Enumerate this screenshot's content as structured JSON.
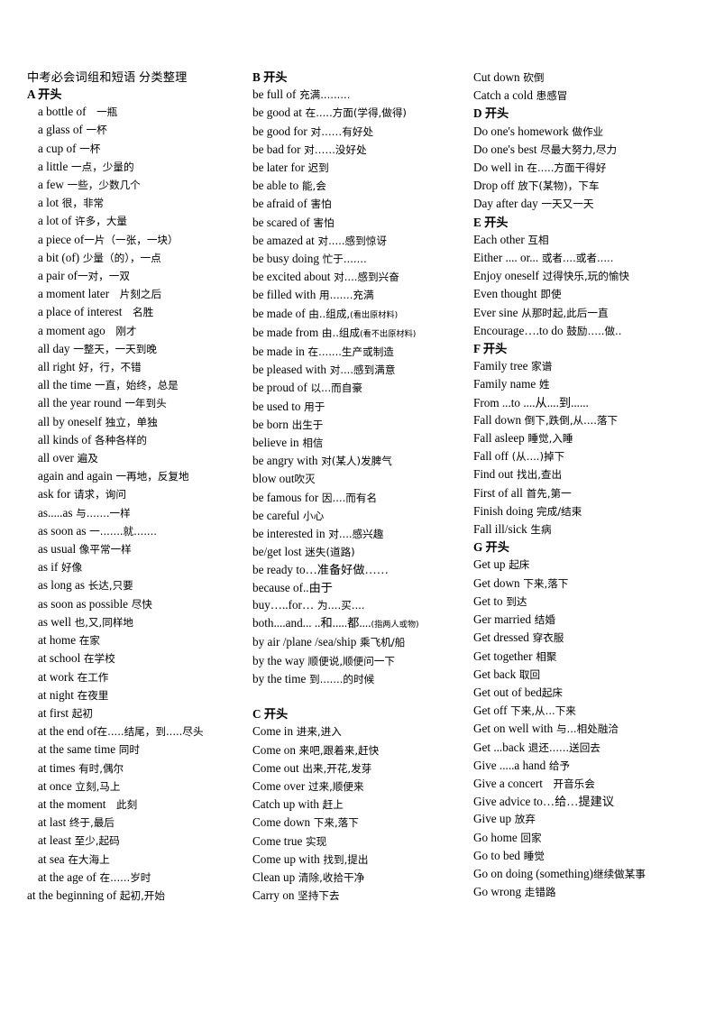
{
  "document": {
    "title": "中考必会词组和短语 分类整理"
  },
  "columns": [
    {
      "id": "column-1",
      "blocks": [
        {
          "type": "title",
          "text": "中考必会词组和短语 分类整理"
        },
        {
          "type": "heading",
          "text": "A 开头"
        },
        {
          "type": "entry",
          "en": "a bottle of",
          "cn": "　一瓶"
        },
        {
          "type": "entry",
          "en": "a glass of",
          "cn": " 一杯"
        },
        {
          "type": "entry",
          "en": "a cup of",
          "cn": " 一杯"
        },
        {
          "type": "entry",
          "en": "a little",
          "cn": " 一点，少量的"
        },
        {
          "type": "entry",
          "en": "a few",
          "cn": " 一些，少数几个"
        },
        {
          "type": "entry",
          "en": "a lot",
          "cn": " 很，非常"
        },
        {
          "type": "entry",
          "en": "a lot of",
          "cn": " 许多，大量"
        },
        {
          "type": "entry",
          "en": "a piece of",
          "cn": "一片（一张，一块）"
        },
        {
          "type": "entry",
          "en": "a bit (of)",
          "cn": " 少量（的），一点"
        },
        {
          "type": "entry",
          "en": "a pair of",
          "cn": "一对，一双"
        },
        {
          "type": "entry",
          "en": "a moment later",
          "cn": "　片刻之后"
        },
        {
          "type": "entry",
          "en": "a place of interest",
          "cn": "　名胜"
        },
        {
          "type": "entry",
          "en": "a moment ago",
          "cn": "　刚才"
        },
        {
          "type": "entry",
          "en": "all day",
          "cn": " 一整天，一天到晚"
        },
        {
          "type": "entry",
          "en": "all right",
          "cn": " 好，行，不错"
        },
        {
          "type": "entry",
          "en": "all the time",
          "cn": " 一直，始终，总是"
        },
        {
          "type": "entry",
          "en": "all the year round",
          "cn": " 一年到头"
        },
        {
          "type": "entry",
          "en": "all by oneself",
          "cn": " 独立，单独"
        },
        {
          "type": "entry",
          "en": "all kinds of",
          "cn": " 各种各样的"
        },
        {
          "type": "entry",
          "en": "all over",
          "cn": " 遍及"
        },
        {
          "type": "entry",
          "en": "again and again",
          "cn": " 一再地，反复地"
        },
        {
          "type": "entry",
          "en": "ask for",
          "cn": " 请求，询问"
        },
        {
          "type": "entry",
          "en": "as.....as",
          "cn": " 与.......一样"
        },
        {
          "type": "entry",
          "en": "as  soon   as",
          "cn": " 一.......就......."
        },
        {
          "type": "entry",
          "en": "as usual",
          "cn": " 像平常一样"
        },
        {
          "type": "entry",
          "en": "as if",
          "cn": " 好像"
        },
        {
          "type": "entry",
          "en": "as long as",
          "cn": " 长达,只要"
        },
        {
          "type": "entry",
          "en": "as soon as possible",
          "cn": " 尽快"
        },
        {
          "type": "entry",
          "en": "as well",
          "cn": " 也,又,同样地"
        },
        {
          "type": "entry",
          "en": "at home",
          "cn": " 在家"
        },
        {
          "type": "entry",
          "en": "at school",
          "cn": " 在学校"
        },
        {
          "type": "entry",
          "en": "at work",
          "cn": " 在工作"
        },
        {
          "type": "entry",
          "en": "at night",
          "cn": " 在夜里"
        },
        {
          "type": "entry",
          "en": "at first",
          "cn": " 起初"
        },
        {
          "type": "entry",
          "en": "at the end of",
          "cn": "在.....结尾，到.....尽头"
        },
        {
          "type": "entry",
          "en": "at the same time",
          "cn": " 同时"
        },
        {
          "type": "entry",
          "en": "at times",
          "cn": " 有时,偶尔"
        },
        {
          "type": "entry",
          "en": "at once",
          "cn": " 立刻,马上"
        },
        {
          "type": "entry",
          "en": "at the moment",
          "cn": "　此刻"
        },
        {
          "type": "entry",
          "en": "at last",
          "cn": " 终于,最后"
        },
        {
          "type": "entry",
          "en": "at least",
          "cn": " 至少,起码"
        },
        {
          "type": "entry",
          "en": "at sea",
          "cn": " 在大海上"
        },
        {
          "type": "entry",
          "en": "at the age of",
          "cn": " 在......岁时"
        },
        {
          "type": "entry",
          "en": "at the beginning of",
          "cn": " 起初,开始",
          "flush": true
        }
      ]
    },
    {
      "id": "column-2",
      "blocks": [
        {
          "type": "heading",
          "text": "B 开头"
        },
        {
          "type": "entry",
          "en": "be full of",
          "cn": " 充满........."
        },
        {
          "type": "entry",
          "en": "be good at",
          "cn": " 在.....方面(学得,做得)"
        },
        {
          "type": "entry",
          "en": "be good for",
          "cn": " 对……有好处"
        },
        {
          "type": "entry",
          "en": "be bad for",
          "cn": " 对……没好处"
        },
        {
          "type": "entry",
          "en": "be later for",
          "cn": " 迟到"
        },
        {
          "type": "entry",
          "en": "be able to",
          "cn": " 能,会"
        },
        {
          "type": "entry",
          "en": "be afraid of",
          "cn": " 害怕"
        },
        {
          "type": "entry",
          "en": "be scared of",
          "cn": " 害怕"
        },
        {
          "type": "entry",
          "en": "be amazed at",
          "cn": " 对.....感到惊讶"
        },
        {
          "type": "entry",
          "en": "be busy doing",
          "cn": " 忙于......."
        },
        {
          "type": "entry",
          "en": "be excited about",
          "cn": " 对....感到兴奋"
        },
        {
          "type": "entry",
          "en": "be filled with",
          "cn": " 用.......充满"
        },
        {
          "type": "entry",
          "en": "be made of",
          "cn": " 由..组成,",
          "cn_small": "(看出原材料)"
        },
        {
          "type": "entry",
          "en": "be made from",
          "cn": " 由..组成",
          "cn_small": "(看不出原材料)"
        },
        {
          "type": "entry",
          "en": "be made in",
          "cn": " 在.......生产或制造"
        },
        {
          "type": "entry",
          "en": "be pleased with",
          "cn": " 对....感到满意"
        },
        {
          "type": "entry",
          "en": "be proud of",
          "cn": " 以...而自豪"
        },
        {
          "type": "entry",
          "en": "be used to",
          "cn": " 用于"
        },
        {
          "type": "entry",
          "en": "be born",
          "cn": " 出生于"
        },
        {
          "type": "entry",
          "en": "believe in",
          "cn": " 相信"
        },
        {
          "type": "entry",
          "en": "be angry with",
          "cn": " 对(某人)发脾气"
        },
        {
          "type": "entry",
          "en": "blow out",
          "cn": "吹灭"
        },
        {
          "type": "entry",
          "en": "be famous for",
          "cn": " 因....而有名"
        },
        {
          "type": "entry",
          "en": "be careful",
          "cn": " 小心"
        },
        {
          "type": "entry",
          "en": "be interested in",
          "cn": " 对....感兴趣"
        },
        {
          "type": "entry",
          "en": "be/get lost",
          "cn": " 迷失(道路)"
        },
        {
          "type": "entry",
          "en": "be ready to…准备好做……"
        },
        {
          "type": "entry",
          "en": "because of..由于"
        },
        {
          "type": "entry",
          "en": "buy…..for…",
          "cn": " 为....买...."
        },
        {
          "type": "entry",
          "en": "both....and... ..和.....都....",
          "cn_small": "(指两人或物)"
        },
        {
          "type": "entry",
          "en": "by air /plane /sea/ship",
          "cn": " 乘飞机/船"
        },
        {
          "type": "entry",
          "en": "by the way",
          "cn": " 顺便说,顺便问一下"
        },
        {
          "type": "entry",
          "en": "by the time",
          "cn": " 到.......的时候"
        },
        {
          "type": "spacer"
        },
        {
          "type": "heading",
          "text": "C 开头"
        },
        {
          "type": "entry",
          "en": "Come in",
          "cn": " 进来,进入"
        },
        {
          "type": "entry",
          "en": "Come on",
          "cn": " 来吧,跟着来,赶快"
        },
        {
          "type": "entry",
          "en": "Come out",
          "cn": " 出来,开花,发芽"
        },
        {
          "type": "entry",
          "en": "Come over",
          "cn": " 过来,顺便来"
        },
        {
          "type": "entry",
          "en": "Catch up with",
          "cn": " 赶上"
        },
        {
          "type": "entry",
          "en": "Come down",
          "cn": " 下来,落下"
        },
        {
          "type": "entry",
          "en": "Come true",
          "cn": " 实现"
        },
        {
          "type": "entry",
          "en": "Come up with",
          "cn": " 找到,提出"
        },
        {
          "type": "entry",
          "en": "Clean up",
          "cn": " 清除,收拾干净"
        },
        {
          "type": "entry",
          "en": "Carry on",
          "cn": " 坚持下去"
        }
      ]
    },
    {
      "id": "column-3",
      "blocks": [
        {
          "type": "entry",
          "en": "Cut down",
          "cn": " 砍倒"
        },
        {
          "type": "entry",
          "en": "Catch a cold",
          "cn": " 患感冒"
        },
        {
          "type": "heading",
          "text": "D 开头"
        },
        {
          "type": "entry",
          "en": "Do one's homework",
          "cn": " 做作业"
        },
        {
          "type": "entry",
          "en": "Do one's best",
          "cn": " 尽最大努力,尽力"
        },
        {
          "type": "entry",
          "en": "Do well in",
          "cn": " 在.....方面干得好"
        },
        {
          "type": "entry",
          "en": "Drop off",
          "cn": " 放下(某物)，下车"
        },
        {
          "type": "entry",
          "en": "Day after day",
          "cn": " 一天又一天"
        },
        {
          "type": "heading",
          "text": "E 开头"
        },
        {
          "type": "entry",
          "en": "Each other",
          "cn": " 互相"
        },
        {
          "type": "entry",
          "en": "Either .... or...",
          "cn": " 或者....或者....."
        },
        {
          "type": "entry",
          "en": "Enjoy oneself",
          "cn": " 过得快乐,玩的愉快"
        },
        {
          "type": "entry",
          "en": "Even thought",
          "cn": " 即使"
        },
        {
          "type": "entry",
          "en": "Ever sine",
          "cn": " 从那时起,此后一直"
        },
        {
          "type": "entry",
          "en": "Encourage….to do",
          "cn": " 鼓励…..做.."
        },
        {
          "type": "heading",
          "text": "F 开头"
        },
        {
          "type": "entry",
          "en": "Family tree",
          "cn": " 家谱"
        },
        {
          "type": "entry",
          "en": "Family name",
          "cn": " 姓"
        },
        {
          "type": "entry",
          "en": "From ...to ....从....到......"
        },
        {
          "type": "entry",
          "en": "Fall down",
          "cn": " 倒下,跌倒,从....落下"
        },
        {
          "type": "entry",
          "en": "Fall asleep",
          "cn": " 睡觉,入睡"
        },
        {
          "type": "entry",
          "en": "Fall off",
          "cn": " (从....)掉下"
        },
        {
          "type": "entry",
          "en": "Find out",
          "cn": " 找出,查出"
        },
        {
          "type": "entry",
          "en": "First of all",
          "cn": " 首先,第一"
        },
        {
          "type": "entry",
          "en": "Finish doing",
          "cn": " 完成/结束"
        },
        {
          "type": "entry",
          "en": "Fall ill/sick",
          "cn": " 生病"
        },
        {
          "type": "heading",
          "text": "G 开头"
        },
        {
          "type": "entry",
          "en": "Get up",
          "cn": " 起床"
        },
        {
          "type": "entry",
          "en": "Get down",
          "cn": " 下来,落下"
        },
        {
          "type": "entry",
          "en": "Get to",
          "cn": " 到达"
        },
        {
          "type": "entry",
          "en": "Ger married",
          "cn": " 结婚"
        },
        {
          "type": "entry",
          "en": "Get dressed",
          "cn": " 穿衣服"
        },
        {
          "type": "entry",
          "en": "Get together",
          "cn": " 相聚"
        },
        {
          "type": "entry",
          "en": "Get back",
          "cn": " 取回"
        },
        {
          "type": "entry",
          "en": "Get out of bed",
          "cn": "起床"
        },
        {
          "type": "entry",
          "en": "Get off",
          "cn": " 下来,从...下来"
        },
        {
          "type": "entry",
          "en": "Get on well with",
          "cn": " 与...相处融洽"
        },
        {
          "type": "entry",
          "en": "Get ...back",
          "cn": " 退还......送回去"
        },
        {
          "type": "entry",
          "en": "Give .....a hand",
          "cn": " 给予"
        },
        {
          "type": "entry",
          "en": "Give a concert",
          "cn": "　开音乐会"
        },
        {
          "type": "entry",
          "en": "Give advice to…给…提建议"
        },
        {
          "type": "entry",
          "en": "Give up",
          "cn": " 放弃"
        },
        {
          "type": "entry",
          "en": "Go home",
          "cn": " 回家"
        },
        {
          "type": "entry",
          "en": "Go to bed",
          "cn": " 睡觉"
        },
        {
          "type": "entry",
          "en": "Go on doing (something)",
          "cn": "继续做某事"
        },
        {
          "type": "entry",
          "en": "Go wrong",
          "cn": " 走错路"
        }
      ]
    }
  ]
}
